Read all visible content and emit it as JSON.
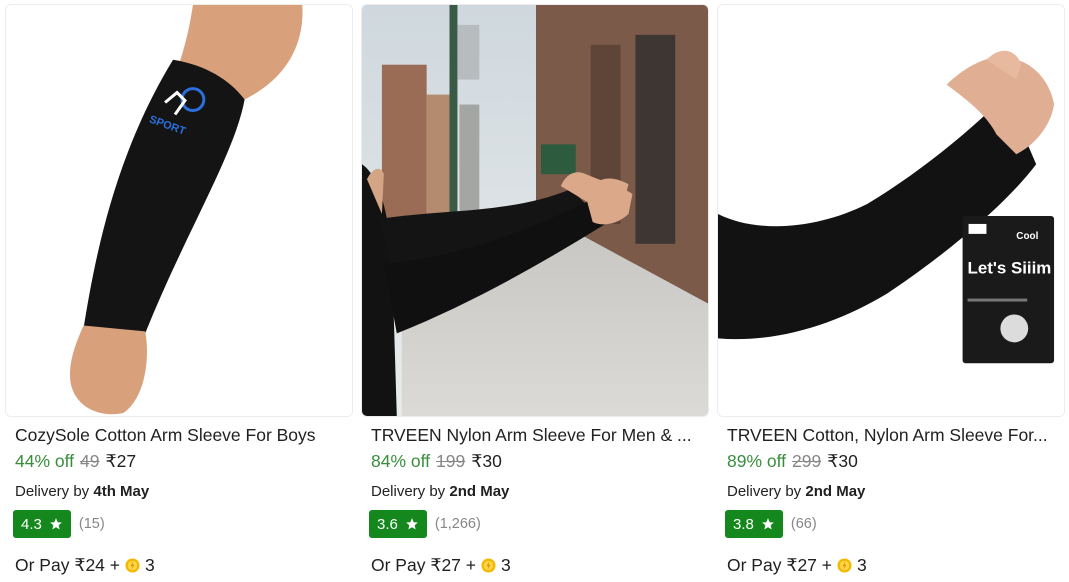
{
  "products": [
    {
      "title": "CozySole Cotton Arm Sleeve For Boys",
      "discount": "44% off",
      "mrp": "49",
      "price": "₹27",
      "delivery_prefix": "Delivery by",
      "delivery_date": "4th May",
      "rating": "4.3",
      "rating_count": "(15)",
      "pay_text": "Or Pay ₹24 +",
      "coins": "3",
      "image_label": "SPORT"
    },
    {
      "title": "TRVEEN Nylon Arm Sleeve For Men & ...",
      "discount": "84% off",
      "mrp": "199",
      "price": "₹30",
      "delivery_prefix": "Delivery by",
      "delivery_date": "2nd May",
      "rating": "3.6",
      "rating_count": "(1,266)",
      "pay_text": "Or Pay ₹27 +",
      "coins": "3"
    },
    {
      "title": "TRVEEN Cotton, Nylon Arm Sleeve For...",
      "discount": "89% off",
      "mrp": "299",
      "price": "₹30",
      "delivery_prefix": "Delivery by",
      "delivery_date": "2nd May",
      "rating": "3.8",
      "rating_count": "(66)",
      "pay_text": "Or Pay ₹27 +",
      "coins": "3",
      "image_label": "Let's Siiim",
      "pack_text": "Cool"
    }
  ],
  "colors": {
    "discount": "#388e3c",
    "rating_badge": "#14881c",
    "muted": "#878787",
    "coin": "#f5b800"
  },
  "icons": {
    "rating": "star-icon",
    "supercoin": "coin-icon"
  }
}
